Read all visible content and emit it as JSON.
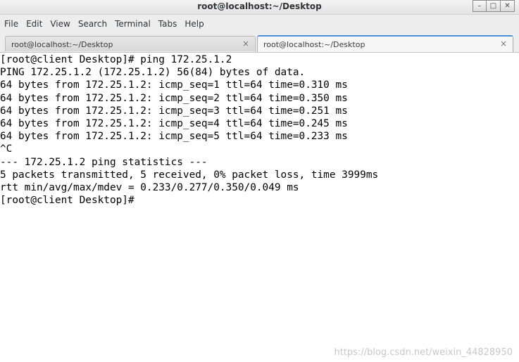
{
  "window": {
    "title": "root@localhost:~/Desktop"
  },
  "menu": [
    "File",
    "Edit",
    "View",
    "Search",
    "Terminal",
    "Tabs",
    "Help"
  ],
  "tabs": [
    {
      "label": "root@localhost:~/Desktop",
      "active": false
    },
    {
      "label": "root@localhost:~/Desktop",
      "active": true
    }
  ],
  "terminal": {
    "lines": [
      "[root@client Desktop]# ping 172.25.1.2",
      "PING 172.25.1.2 (172.25.1.2) 56(84) bytes of data.",
      "64 bytes from 172.25.1.2: icmp_seq=1 ttl=64 time=0.310 ms",
      "64 bytes from 172.25.1.2: icmp_seq=2 ttl=64 time=0.350 ms",
      "64 bytes from 172.25.1.2: icmp_seq=3 ttl=64 time=0.251 ms",
      "64 bytes from 172.25.1.2: icmp_seq=4 ttl=64 time=0.245 ms",
      "64 bytes from 172.25.1.2: icmp_seq=5 ttl=64 time=0.233 ms",
      "^C",
      "--- 172.25.1.2 ping statistics ---",
      "5 packets transmitted, 5 received, 0% packet loss, time 3999ms",
      "rtt min/avg/max/mdev = 0.233/0.277/0.350/0.049 ms",
      "[root@client Desktop]#"
    ]
  },
  "watermark": "https://blog.csdn.net/weixin_44828950",
  "icons": {
    "minimize": "minimize-icon",
    "maximize": "maximize-icon",
    "close": "close-icon"
  }
}
